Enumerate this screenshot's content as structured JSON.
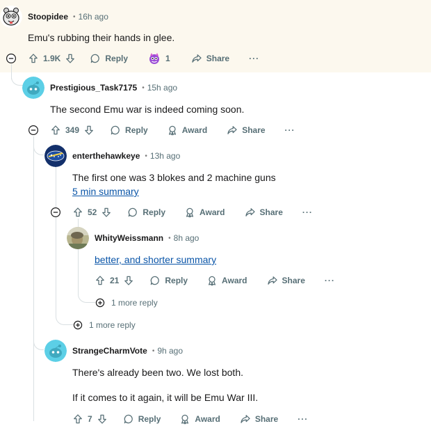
{
  "comments": [
    {
      "user": "Stoopidee",
      "time": "16h ago",
      "body": "Emu's rubbing their hands in glee.",
      "votes": "1.9K",
      "reply_label": "Reply",
      "award_count": "1",
      "share_label": "Share",
      "more_label": "···"
    },
    {
      "user": "Prestigious_Task7175",
      "time": "15h ago",
      "body": "The second Emu war is indeed coming soon.",
      "votes": "349",
      "reply_label": "Reply",
      "award_label": "Award",
      "share_label": "Share",
      "more_label": "···"
    },
    {
      "user": "enterthehawkeye",
      "time": "13h ago",
      "body": "The first one was 3 blokes and 2 machine guns",
      "link": "5 min summary",
      "votes": "52",
      "reply_label": "Reply",
      "award_label": "Award",
      "share_label": "Share",
      "more_label": "···"
    },
    {
      "user": "WhityWeissmann",
      "time": "8h ago",
      "link": "better, and shorter summary",
      "votes": "21",
      "reply_label": "Reply",
      "award_label": "Award",
      "share_label": "Share",
      "more_label": "···"
    },
    {
      "user": "StrangeCharmVote",
      "time": "9h ago",
      "body": "There's already been two. We lost both.",
      "body2": "If it comes to it again, it will be Emu War III.",
      "votes": "7",
      "reply_label": "Reply",
      "award_label": "Award",
      "share_label": "Share",
      "more_label": "···"
    }
  ],
  "more_replies": [
    "1 more reply",
    "1 more reply"
  ],
  "dot": "•",
  "colors": {
    "highlight": "#fcf8ee",
    "link": "#0a55a8",
    "meta": "#576f76",
    "thread": "#d9dfe2"
  }
}
